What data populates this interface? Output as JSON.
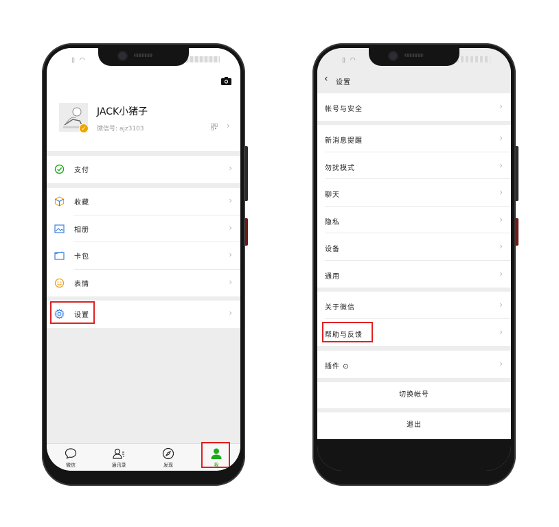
{
  "left_phone": {
    "profile": {
      "nickname": "JACK小猪子",
      "wechat_id": "微信号: ajz3103",
      "verified_mark": "✓"
    },
    "groups": [
      [
        {
          "label": "支付",
          "icon": "wallet-icon"
        }
      ],
      [
        {
          "label": "收藏",
          "icon": "favorites-cube-icon"
        },
        {
          "label": "相册",
          "icon": "album-icon"
        },
        {
          "label": "卡包",
          "icon": "card-wallet-icon"
        },
        {
          "label": "表情",
          "icon": "sticker-smile-icon"
        }
      ],
      [
        {
          "label": "设置",
          "icon": "gear-icon"
        }
      ]
    ],
    "tabs": [
      {
        "label": "微信",
        "icon": "chat-bubble-icon"
      },
      {
        "label": "通讯录",
        "icon": "contacts-icon"
      },
      {
        "label": "发现",
        "icon": "compass-icon"
      },
      {
        "label": "我",
        "icon": "person-icon"
      }
    ]
  },
  "right_phone": {
    "nav": {
      "back": "‹",
      "title": "设置"
    },
    "groups": [
      [
        "帐号与安全"
      ],
      [
        "新消息提醒",
        "勿扰模式",
        "聊天",
        "隐私",
        "设备",
        "通用"
      ],
      [
        "关于微信",
        "帮助与反馈"
      ],
      [
        "插件 ⊙"
      ]
    ],
    "switch_account": "切换帐号",
    "logout": "退出"
  },
  "colors": {
    "accent_green": "#1aad19",
    "highlight_red": "#e02020",
    "verified_orange": "#f0a400"
  },
  "chevron": "›"
}
